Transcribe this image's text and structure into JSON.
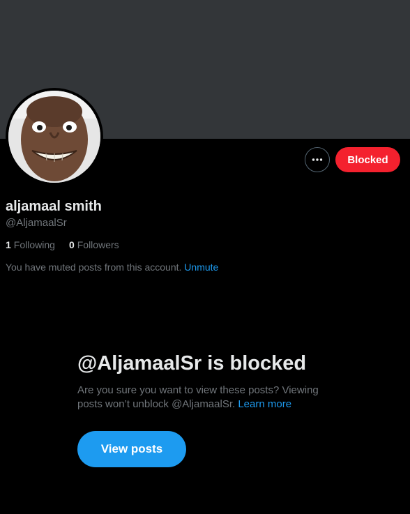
{
  "profile": {
    "display_name": "aljamaal smith",
    "handle": "@AljamaalSr",
    "following_count": "1",
    "following_label": "Following",
    "followers_count": "0",
    "followers_label": "Followers",
    "muted_text": "You have muted posts from this account.",
    "unmute_label": "Unmute"
  },
  "actions": {
    "more_icon": "more-horizontal-icon",
    "blocked_label": "Blocked"
  },
  "blocked_notice": {
    "title": "@AljamaalSr is blocked",
    "description": "Are you sure you want to view these posts? Viewing posts won’t unblock @AljamaalSr.",
    "learn_more_label": "Learn more",
    "view_posts_label": "View posts"
  },
  "colors": {
    "background": "#000000",
    "banner": "#333639",
    "blocked_red": "#f4212e",
    "accent_blue": "#1d9bf0",
    "muted_gray": "#71767b",
    "text": "#e7e9ea"
  }
}
